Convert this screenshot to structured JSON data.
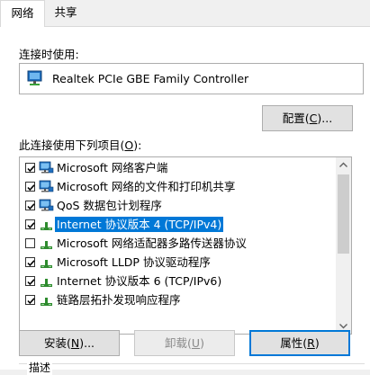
{
  "tabs": [
    {
      "label": "网络",
      "active": true
    },
    {
      "label": "共享",
      "active": false
    }
  ],
  "connect_using": {
    "label": "连接时使用:",
    "adapter_name": "Realtek PCIe GBE Family Controller",
    "adapter_icon": "network-adapter-icon"
  },
  "configure_button": {
    "label": "配置",
    "shortcut": "C",
    "suffix": "..."
  },
  "items_label": {
    "label": "此连接使用下列项目",
    "shortcut": "O",
    "suffix": ":"
  },
  "components": [
    {
      "label": "Microsoft 网络客户端",
      "checked": true,
      "icon": "network-client-icon"
    },
    {
      "label": "Microsoft 网络的文件和打印机共享",
      "checked": true,
      "icon": "network-client-icon"
    },
    {
      "label": "QoS 数据包计划程序",
      "checked": true,
      "icon": "network-client-icon"
    },
    {
      "label": "Internet 协议版本 4 (TCP/IPv4)",
      "checked": true,
      "icon": "protocol-icon",
      "selected": true
    },
    {
      "label": "Microsoft 网络适配器多路传送器协议",
      "checked": false,
      "icon": "protocol-icon"
    },
    {
      "label": "Microsoft LLDP 协议驱动程序",
      "checked": true,
      "icon": "protocol-icon"
    },
    {
      "label": "Internet 协议版本 6 (TCP/IPv6)",
      "checked": true,
      "icon": "protocol-icon"
    },
    {
      "label": "链路层拓扑发现响应程序",
      "checked": true,
      "icon": "protocol-icon"
    }
  ],
  "buttons": {
    "install": {
      "label": "安装",
      "shortcut": "N",
      "suffix": "...",
      "enabled": true
    },
    "uninstall": {
      "label": "卸载",
      "shortcut": "U",
      "suffix": "",
      "enabled": false
    },
    "properties": {
      "label": "属性",
      "shortcut": "R",
      "suffix": "",
      "enabled": true
    }
  },
  "description_label": "描述",
  "colors": {
    "selection": "#0078d7",
    "protocol_icon": "#2e8b2e",
    "monitor_icon": "#1f6fbf"
  }
}
